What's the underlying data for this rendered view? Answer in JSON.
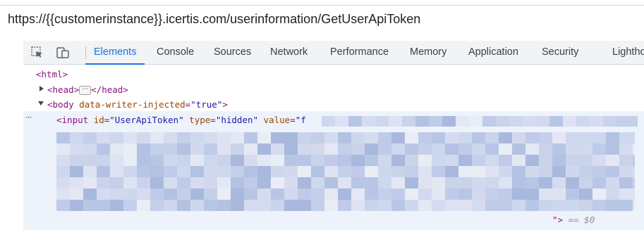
{
  "address_bar": {
    "url": "https://{{customerinstance}}.icertis.com/userinformation/GetUserApiToken"
  },
  "devtools": {
    "toolbar_icons": [
      "select-element-icon",
      "device-toolbar-icon"
    ],
    "tabs": [
      "Elements",
      "Console",
      "Sources",
      "Network",
      "Performance",
      "Memory",
      "Application",
      "Security",
      "Lighthouse"
    ],
    "active_tab": "Elements"
  },
  "dom": {
    "html_open": "<html>",
    "head_open": "<head>",
    "head_close": "</head>",
    "ellipsis": "···",
    "body_tag_open": "<body ",
    "body_attr_name": "data-writer-injected",
    "body_eq": "=",
    "body_attr_value": "\"true\"",
    "body_tag_close": ">",
    "node_menu": "···",
    "input_tag_open": "<input ",
    "input_id_name": "id",
    "input_id_value": "\"UserApiToken\"",
    "input_type_name": "type",
    "input_type_value": "\"hidden\"",
    "input_value_name": "value",
    "input_value_start": "\"f",
    "input_end": "\">",
    "selected_marker": "== $0"
  },
  "colors": {
    "tag": "#881280",
    "attribute": "#994500",
    "attribute_value": "#1a1aa6",
    "accent": "#1a73e8"
  }
}
